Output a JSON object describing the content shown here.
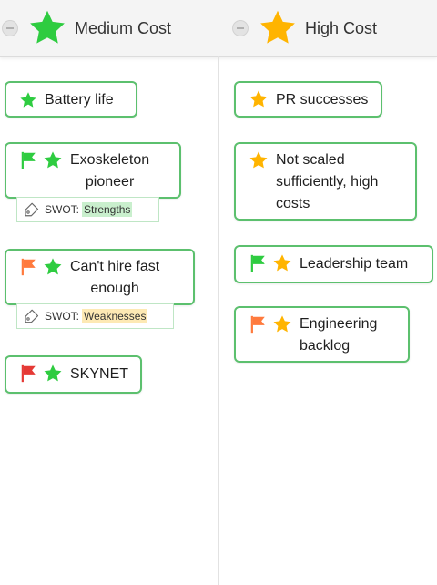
{
  "columns": [
    {
      "title": "Medium Cost",
      "star_color": "#2ecc40"
    },
    {
      "title": "High Cost",
      "star_color": "#ffb400"
    }
  ],
  "colors": {
    "card_border": "#5cc06e",
    "star_green": "#2ecc40",
    "star_orange": "#ffb400",
    "flag_green": "#2ecc40",
    "flag_orange": "#ff7a3d",
    "flag_red": "#e53935"
  },
  "medium_cost_cards": [
    {
      "text": "Battery life",
      "flag": null
    },
    {
      "line1": "Exoskeleton",
      "line2": "pioneer",
      "flag": "green",
      "tag": {
        "label": "SWOT:",
        "value": "Strengths"
      }
    },
    {
      "line1": "Can't hire fast",
      "line2": "enough",
      "flag": "orange",
      "tag": {
        "label": "SWOT:",
        "value": "Weaknesses"
      }
    },
    {
      "text": "SKYNET",
      "flag": "red"
    }
  ],
  "high_cost_cards": [
    {
      "text": "PR successes",
      "flag": null
    },
    {
      "line1": "Not scaled",
      "line2": "sufficiently, high",
      "line3": "costs",
      "flag": null
    },
    {
      "text": "Leadership team",
      "flag": "green"
    },
    {
      "line1": "Engineering",
      "line2": "backlog",
      "flag": "orange"
    }
  ]
}
